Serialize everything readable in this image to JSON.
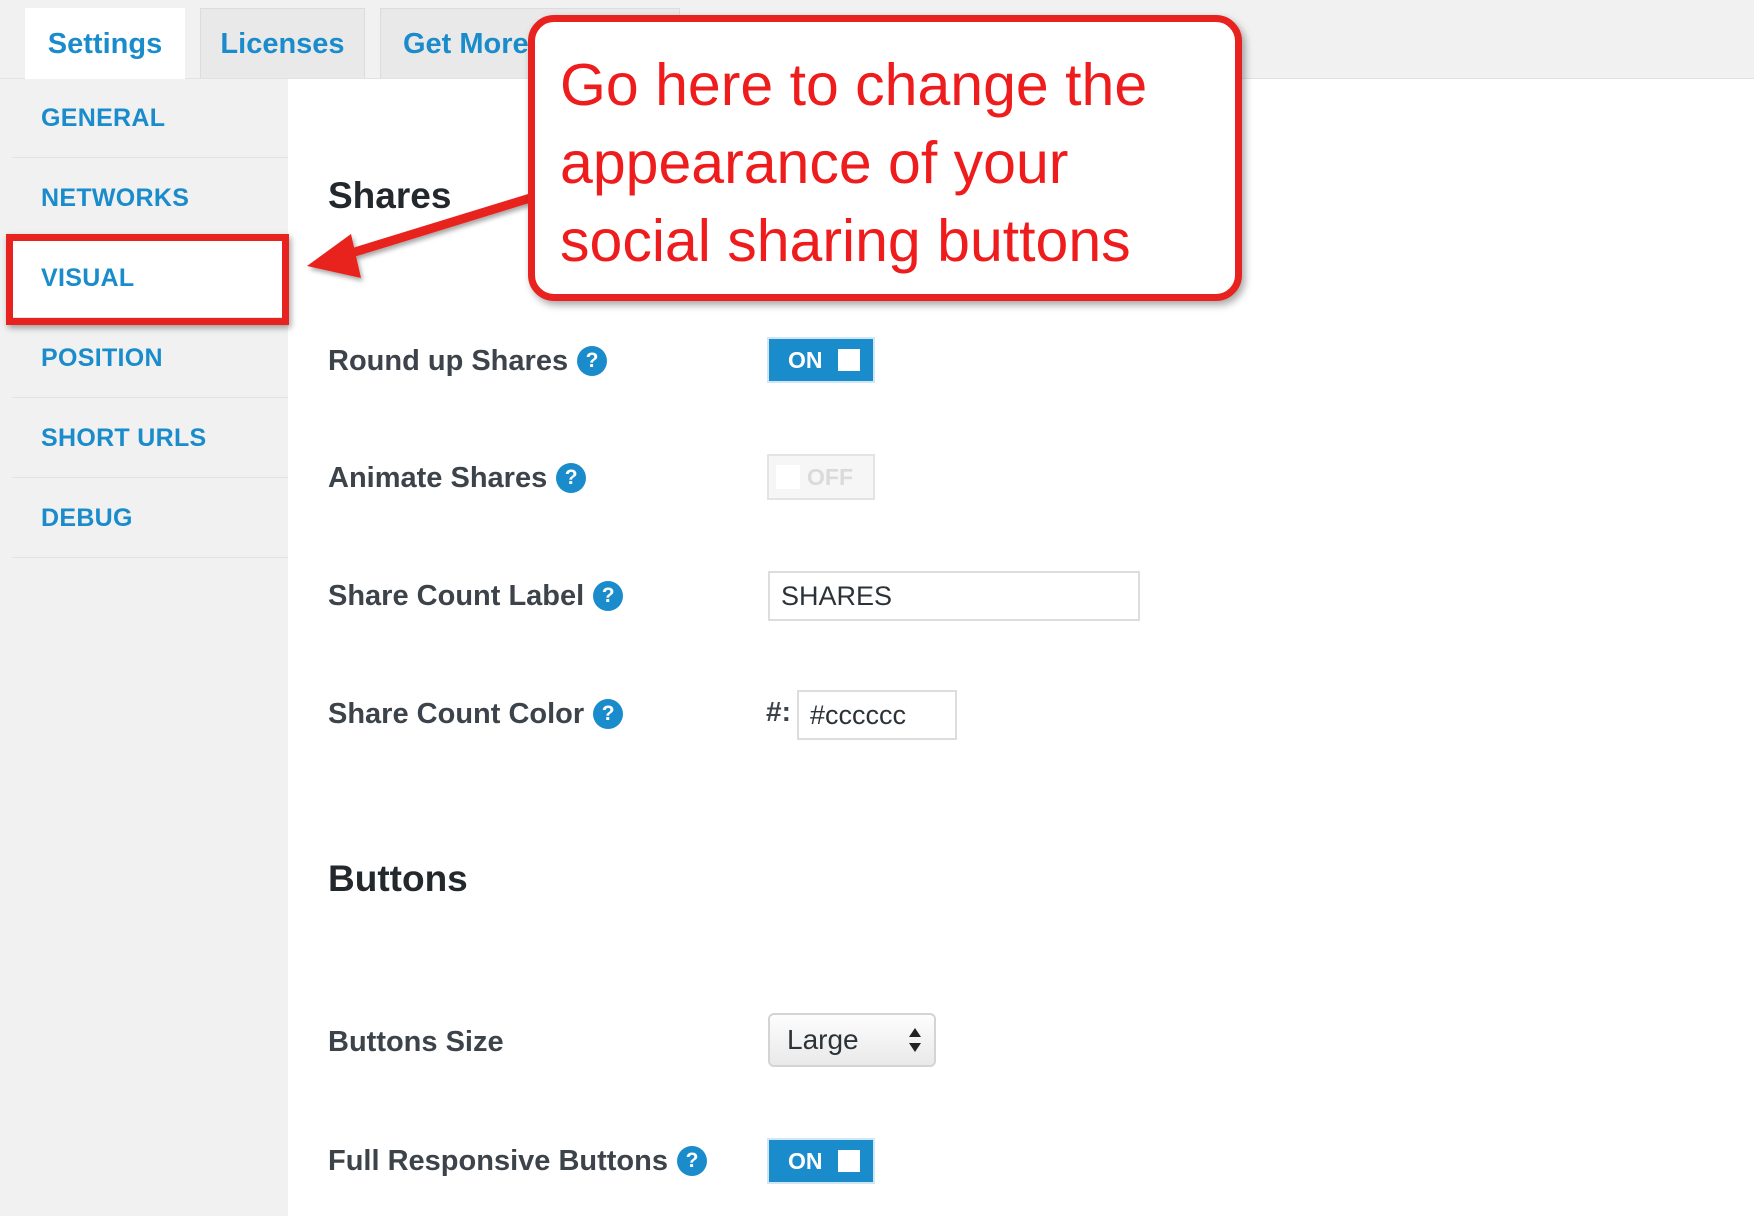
{
  "tabs": [
    {
      "label": "Settings",
      "active": true
    },
    {
      "label": "Licenses",
      "active": false
    },
    {
      "label": "Get More",
      "active": false
    }
  ],
  "sidebar": {
    "items": [
      {
        "label": "GENERAL"
      },
      {
        "label": "NETWORKS"
      },
      {
        "label": "VISUAL",
        "active": true
      },
      {
        "label": "POSITION"
      },
      {
        "label": "SHORT URLS"
      },
      {
        "label": "DEBUG"
      }
    ]
  },
  "callout": {
    "lines": [
      "Go here to change the",
      "appearance of your",
      "social sharing buttons"
    ],
    "color": "#e8231f"
  },
  "shares": {
    "title": "Shares",
    "round_up": {
      "label": "Round up Shares",
      "toggle_text": "ON",
      "state": true
    },
    "animate": {
      "label": "Animate Shares",
      "toggle_text": "OFF",
      "state": false
    },
    "count_label": {
      "label": "Share Count Label",
      "value": "SHARES"
    },
    "count_color": {
      "label": "Share Count Color",
      "prefix": "#:",
      "value": "#cccccc"
    }
  },
  "buttons": {
    "title": "Buttons",
    "size": {
      "label": "Buttons Size",
      "value": "Large"
    },
    "full_responsive": {
      "label": "Full Responsive Buttons",
      "toggle_text": "ON",
      "state": true
    }
  },
  "help_glyph": "?",
  "colors": {
    "accent": "#1a8ccb",
    "annotation_red": "#e8231f",
    "sidebar_bg": "#f1f1f1"
  },
  "icons": {
    "help": "question-circle-icon",
    "select_arrows": "up-down-arrows-icon",
    "annotation": "arrow-icon"
  }
}
